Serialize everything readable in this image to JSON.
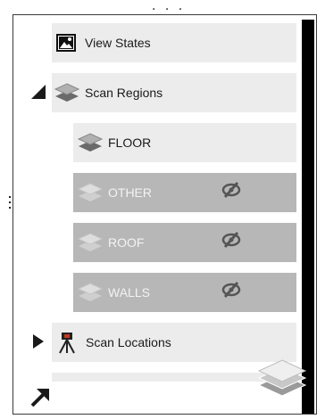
{
  "top_more": "· · ·",
  "tree": {
    "view_states": {
      "label": "View States",
      "icon": "photo-icon"
    },
    "scan_regions": {
      "label": "Scan Regions",
      "icon": "layers-icon",
      "expanded": true,
      "children": [
        {
          "label": "FLOOR",
          "icon": "layers-icon",
          "hidden": false
        },
        {
          "label": "OTHER",
          "icon": "layers-icon",
          "hidden": true,
          "hidden_icon": "eye-slash-icon"
        },
        {
          "label": "ROOF",
          "icon": "layers-icon",
          "hidden": true,
          "hidden_icon": "eye-slash-icon"
        },
        {
          "label": "WALLS",
          "icon": "layers-icon",
          "hidden": true,
          "hidden_icon": "eye-slash-icon"
        }
      ]
    },
    "scan_locations": {
      "label": "Scan Locations",
      "icon": "survey-tripod-icon",
      "expanded": false
    }
  },
  "colors": {
    "row_light": "#ececec",
    "row_hidden": "#b7b7b7",
    "scrollbar": "#000000"
  }
}
